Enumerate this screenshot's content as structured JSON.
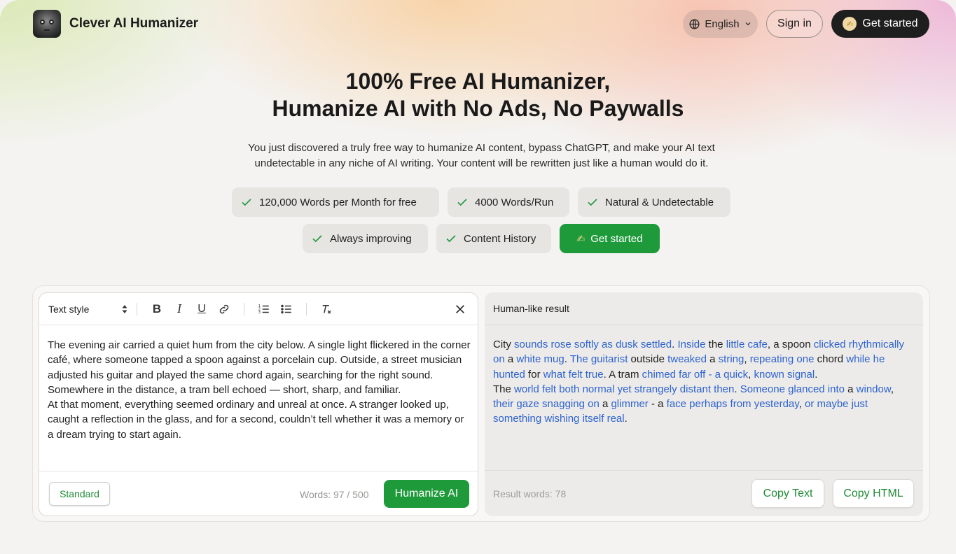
{
  "header": {
    "brand": "Clever AI Humanizer",
    "language": "English",
    "sign_in": "Sign in",
    "get_started": "Get started"
  },
  "hero": {
    "title_line1": "100% Free AI Humanizer,",
    "title_line2": "Humanize AI with No Ads, No Paywalls",
    "subtitle": "You just discovered a truly free way to humanize AI content, bypass ChatGPT, and make your AI text undetectable in any niche of AI writing. Your content will be rewritten just like a human would do it.",
    "features": [
      "120,000 Words per Month for free",
      "4000 Words/Run",
      "Natural & Undetectable",
      "Always improving",
      "Content History"
    ],
    "cta": "Get started"
  },
  "editor": {
    "text_style": "Text style",
    "paragraph1": "The evening air carried a quiet hum from the city below. A single light flickered in the corner café, where someone tapped a spoon against a porcelain cup. Outside, a street musician adjusted his guitar and played the same chord again, searching for the right sound. Somewhere in the distance, a tram bell echoed — short, sharp, and familiar.",
    "paragraph2": "At that moment, everything seemed ordinary and unreal at once. A stranger looked up, caught a reflection in the glass, and for a second, couldn’t tell whether it was a memory or a dream trying to start again.",
    "mode": "Standard",
    "word_count": "Words: 97 / 500",
    "humanize": "Humanize AI"
  },
  "result": {
    "heading": "Human-like result",
    "segments1": [
      {
        "t": "City ",
        "c": false
      },
      {
        "t": "sounds rose softly as dusk settled",
        "c": true
      },
      {
        "t": ". ",
        "c": false
      },
      {
        "t": "Inside",
        "c": true
      },
      {
        "t": " the ",
        "c": false
      },
      {
        "t": "little cafe",
        "c": true
      },
      {
        "t": ", a spoon ",
        "c": false
      },
      {
        "t": "clicked rhythmically on",
        "c": true
      },
      {
        "t": " a ",
        "c": false
      },
      {
        "t": "white mug",
        "c": true
      },
      {
        "t": ". ",
        "c": false
      },
      {
        "t": "The guitarist",
        "c": true
      },
      {
        "t": " outside ",
        "c": false
      },
      {
        "t": "tweaked",
        "c": true
      },
      {
        "t": " a ",
        "c": false
      },
      {
        "t": "string",
        "c": true
      },
      {
        "t": ", ",
        "c": false
      },
      {
        "t": "repeating one",
        "c": true
      },
      {
        "t": " chord ",
        "c": false
      },
      {
        "t": "while he hunted",
        "c": true
      },
      {
        "t": " for ",
        "c": false
      },
      {
        "t": "what felt true",
        "c": true
      },
      {
        "t": ". A tram ",
        "c": false
      },
      {
        "t": "chimed far off",
        "c": true
      },
      {
        "t": " ",
        "c": false
      },
      {
        "t": "-",
        "c": true
      },
      {
        "t": " ",
        "c": false
      },
      {
        "t": "a quick",
        "c": true
      },
      {
        "t": ", ",
        "c": false
      },
      {
        "t": "known signal",
        "c": true
      },
      {
        "t": ".",
        "c": false
      }
    ],
    "segments2": [
      {
        "t": "The ",
        "c": false
      },
      {
        "t": "world felt both normal yet strangely distant then",
        "c": true
      },
      {
        "t": ". ",
        "c": false
      },
      {
        "t": "Someone glanced into",
        "c": true
      },
      {
        "t": " a ",
        "c": false
      },
      {
        "t": "window",
        "c": true
      },
      {
        "t": ", ",
        "c": false
      },
      {
        "t": "their gaze snagging on",
        "c": true
      },
      {
        "t": " a ",
        "c": false
      },
      {
        "t": "glimmer",
        "c": true
      },
      {
        "t": " - a ",
        "c": false
      },
      {
        "t": "face perhaps from yesterday",
        "c": true
      },
      {
        "t": ", ",
        "c": false
      },
      {
        "t": "or maybe just something wishing itself real",
        "c": true
      },
      {
        "t": ".",
        "c": false
      }
    ],
    "word_count": "Result words: 78",
    "copy_text": "Copy Text",
    "copy_html": "Copy HTML"
  },
  "colors": {
    "accent_green": "#1f9a3b",
    "changed_text_blue": "#2e63cf"
  }
}
